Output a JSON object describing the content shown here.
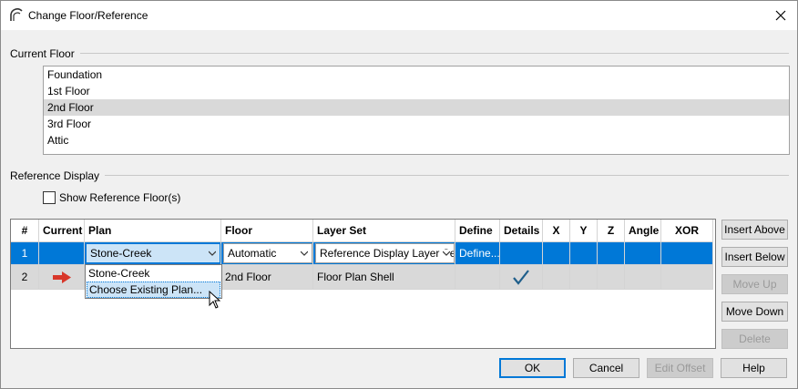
{
  "window": {
    "title": "Change Floor/Reference"
  },
  "current_floor": {
    "label": "Current Floor",
    "items": [
      "Foundation",
      "1st Floor",
      "2nd Floor",
      "3rd Floor",
      "Attic"
    ],
    "selected": "2nd Floor"
  },
  "reference_display": {
    "label": "Reference Display",
    "show_reference_label": "Show Reference Floor(s)",
    "show_reference_checked": false
  },
  "table": {
    "columns": [
      "#",
      "Current",
      "Plan",
      "Floor",
      "Layer Set",
      "Define",
      "Details",
      "X",
      "Y",
      "Z",
      "Angle",
      "XOR"
    ],
    "rows": [
      {
        "num": "1",
        "plan": "Stone-Creek",
        "floor": "Automatic",
        "layer_set": "Reference Display Layer Set",
        "define": "Define...",
        "details": ""
      },
      {
        "num": "2",
        "plan": "Stone-Creek",
        "floor": "2nd Floor",
        "layer_set": "Floor Plan Shell",
        "define": "",
        "details": "check"
      }
    ],
    "plan_options": [
      "Stone-Creek",
      "Choose Existing Plan..."
    ]
  },
  "side_buttons": {
    "insert_above": "Insert Above",
    "insert_below": "Insert Below",
    "move_up": "Move Up",
    "move_down": "Move Down",
    "delete": "Delete"
  },
  "bottom_buttons": {
    "ok": "OK",
    "cancel": "Cancel",
    "edit_offset": "Edit Offset",
    "help": "Help"
  },
  "colors": {
    "selection_blue": "#0078d7",
    "arrow_red": "#d8372a",
    "check_blue": "#1f5f8b"
  }
}
